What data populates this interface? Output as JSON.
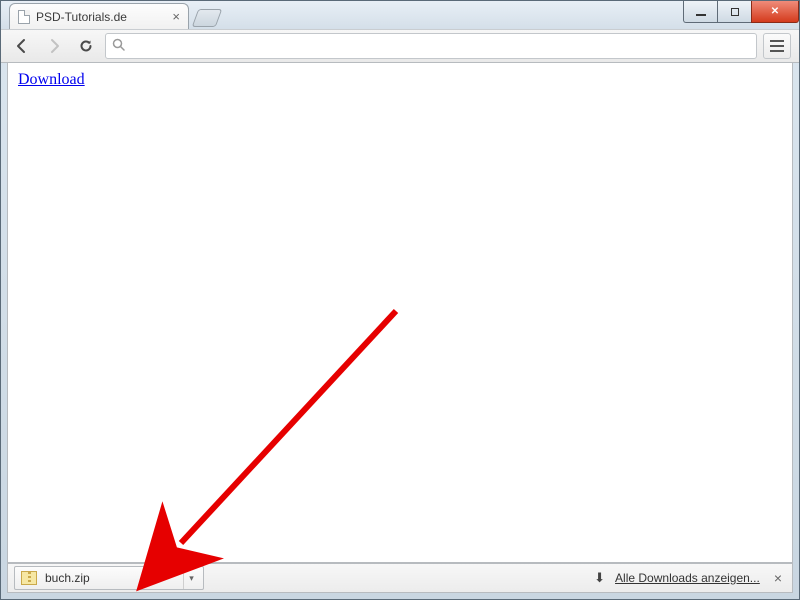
{
  "tab": {
    "title": "PSD-Tutorials.de"
  },
  "omnibox": {
    "value": "",
    "placeholder": ""
  },
  "page": {
    "link_label": "Download"
  },
  "downloads": {
    "item_filename": "buch.zip",
    "show_all_label": "Alle Downloads anzeigen..."
  },
  "icons": {
    "back": "←",
    "forward": "→",
    "reload": "⟳",
    "search": "🔍",
    "close_x": "×",
    "chev_down": "▾",
    "dl_arrow": "⬇"
  }
}
